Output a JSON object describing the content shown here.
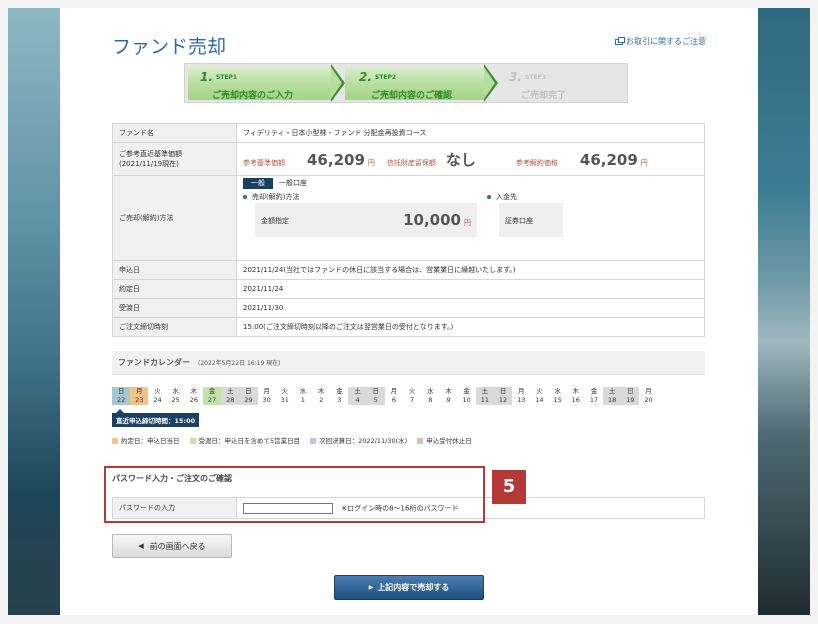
{
  "page": {
    "title": "ファンド売却",
    "notice_link": "お取引に関するご注意"
  },
  "steps": [
    {
      "num": "1.",
      "word": "STEP1",
      "label": "ご売却内容のご入力",
      "state": "active"
    },
    {
      "num": "2.",
      "word": "STEP2",
      "label": "ご売却内容のご確認",
      "state": "active"
    },
    {
      "num": "3.",
      "word": "STEP3",
      "label": "ご売却完了",
      "state": "off"
    }
  ],
  "info": {
    "fund_label": "ファンド名",
    "fund_value": "フィデリティ・日本小型株・ファンド 分配金再投資コース",
    "price_label": "ご参考直近基準価額",
    "price_date": "(2021/11/19現在)",
    "base_price_label": "参考基準価額",
    "base_price_value": "46,209",
    "yen": "円",
    "trust_fee_label": "信託財産留保額",
    "trust_fee_value": "なし",
    "redemption_label": "参考解約価格",
    "redemption_value": "46,209",
    "method_label": "ご売却(解約)方法",
    "tab_general": "一般",
    "account_type": "一般口座",
    "sell_method_label": "売却(解約)方法",
    "amount_type": "金額指定",
    "amount_value": "10,000",
    "deposit_label": "入金先",
    "deposit_value": "証券口座",
    "apply_label": "申込日",
    "apply_value": "2021/11/24(当社ではファンドの休日に該当する場合は、営業業日に繰越いたします。)",
    "contract_label": "約定日",
    "contract_value": "2021/11/24",
    "settle_label": "受渡日",
    "settle_value": "2021/11/30",
    "deadline_label": "ご注文締切時刻",
    "deadline_value": "15:00(ご注文締切時刻以降のご注文は翌営業日の受付となります。)"
  },
  "calendar": {
    "title": "ファンドカレンダー",
    "as_of": "(2022年5月22日 16:19 現在)",
    "days": [
      {
        "w": "日",
        "d": "22",
        "t": "sun"
      },
      {
        "w": "月",
        "d": "23",
        "t": "yesterday"
      },
      {
        "w": "火",
        "d": "24",
        "t": ""
      },
      {
        "w": "水",
        "d": "25",
        "t": ""
      },
      {
        "w": "木",
        "d": "26",
        "t": ""
      },
      {
        "w": "金",
        "d": "27",
        "t": "today"
      },
      {
        "w": "土",
        "d": "28",
        "t": "wknd"
      },
      {
        "w": "日",
        "d": "29",
        "t": "wknd"
      },
      {
        "w": "月",
        "d": "30",
        "t": ""
      },
      {
        "w": "火",
        "d": "31",
        "t": ""
      },
      {
        "w": "水",
        "d": "1",
        "t": ""
      },
      {
        "w": "木",
        "d": "2",
        "t": ""
      },
      {
        "w": "金",
        "d": "3",
        "t": ""
      },
      {
        "w": "土",
        "d": "4",
        "t": "wknd"
      },
      {
        "w": "日",
        "d": "5",
        "t": "wknd"
      },
      {
        "w": "月",
        "d": "6",
        "t": ""
      },
      {
        "w": "火",
        "d": "7",
        "t": ""
      },
      {
        "w": "水",
        "d": "8",
        "t": ""
      },
      {
        "w": "木",
        "d": "9",
        "t": ""
      },
      {
        "w": "金",
        "d": "10",
        "t": ""
      },
      {
        "w": "土",
        "d": "11",
        "t": "wknd"
      },
      {
        "w": "日",
        "d": "12",
        "t": "wknd"
      },
      {
        "w": "月",
        "d": "13",
        "t": ""
      },
      {
        "w": "火",
        "d": "14",
        "t": ""
      },
      {
        "w": "水",
        "d": "15",
        "t": ""
      },
      {
        "w": "木",
        "d": "16",
        "t": ""
      },
      {
        "w": "金",
        "d": "17",
        "t": ""
      },
      {
        "w": "土",
        "d": "18",
        "t": "wknd"
      },
      {
        "w": "日",
        "d": "19",
        "t": "wknd"
      },
      {
        "w": "月",
        "d": "20",
        "t": ""
      }
    ],
    "deadline": "直近申込締切時間：15:00",
    "legend": [
      {
        "label": "約定日：申込日当日",
        "color": "#f5c38a"
      },
      {
        "label": "受渡日：申込日を含めて5営業日目",
        "color": "#c3e3a8"
      },
      {
        "label": "次回決算日：2022/11/30(水)",
        "color": "#c8c0e6"
      },
      {
        "label": "申込受付休止日",
        "color": "#d9bfb0"
      }
    ]
  },
  "password": {
    "section_title": "パスワード入力・ご注文のご確認",
    "label": "パスワードの入力",
    "hint": "※ログイン時の8～16桁のパスワード",
    "value": ""
  },
  "badge": "5",
  "buttons": {
    "back": "前の画面へ戻る",
    "submit": "上記内容で売却する"
  }
}
